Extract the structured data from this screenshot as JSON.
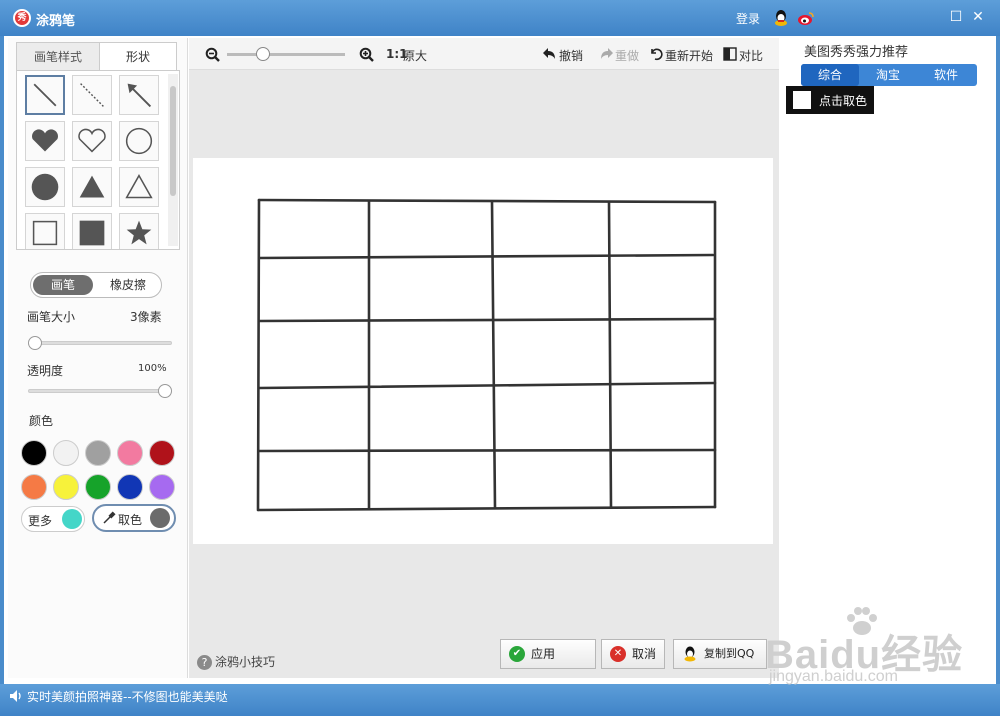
{
  "window": {
    "title": "涂鸦笔",
    "login_label": "登录",
    "maximize_glyph": "☐",
    "close_glyph": "✕"
  },
  "left": {
    "tabs": [
      {
        "label": "画笔样式"
      },
      {
        "label": "形状"
      }
    ],
    "shapes": [
      "line",
      "dashed-line",
      "arrow",
      "heart-filled",
      "heart-outline",
      "circle-outline",
      "circle-filled",
      "triangle-filled",
      "triangle-outline",
      "square-outline",
      "square-filled",
      "star"
    ],
    "mode": {
      "brush": "画笔",
      "eraser": "橡皮擦"
    },
    "brush_size": {
      "label": "画笔大小",
      "value_text": "3像素",
      "level": 0.0
    },
    "opacity": {
      "label": "透明度",
      "value_text": "100%",
      "level": 1.0
    },
    "color_label": "颜色",
    "colors": [
      "#000000",
      "#f2f2f2",
      "#a0a0a0",
      "#f27aa0",
      "#b0121a",
      "#f57a45",
      "#f7f23a",
      "#16a32a",
      "#1136b5",
      "#a66af0"
    ],
    "more_label": "更多",
    "more_color": "#44d6c8",
    "pick_label": "取色",
    "pick_color": "#6b6b6b"
  },
  "toolbar": {
    "zoom_level": 0.28,
    "zoom_text": "1:1",
    "original_label": "原大",
    "undo_label": "撤销",
    "redo_label": "重做",
    "restart_label": "重新开始",
    "compare_label": "对比"
  },
  "canvas": {
    "table_rows": 5,
    "table_cols": 4
  },
  "bottom": {
    "tip_label": "涂鸦小技巧",
    "apply_label": "应用",
    "cancel_label": "取消",
    "copy_label": "复制到QQ"
  },
  "right": {
    "title": "美图秀秀强力推荐",
    "tabs": [
      {
        "label": "综合"
      },
      {
        "label": "淘宝"
      },
      {
        "label": "软件"
      }
    ],
    "tooltip_text": "点击取色"
  },
  "status": {
    "text": "实时美颜拍照神器--不修图也能美美哒"
  },
  "watermark": {
    "brand": "Baidu经验",
    "url": "jingyan.baidu.com"
  }
}
